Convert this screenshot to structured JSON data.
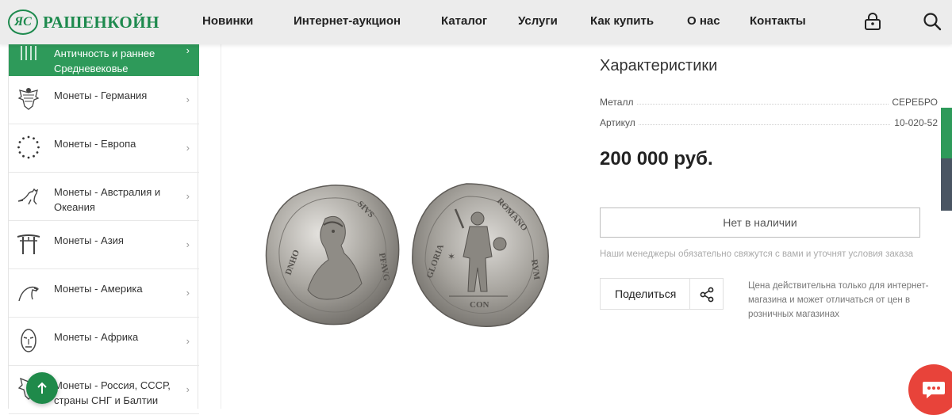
{
  "header": {
    "logo_mark": "ЯС",
    "logo_text": "РАШЕНКОЙН",
    "nav": [
      "Новинки",
      "Интернет-аукцион",
      "Каталог",
      "Услуги",
      "Как купить",
      "О нас",
      "Контакты"
    ],
    "icons": [
      "cart-lock-icon",
      "search-icon"
    ]
  },
  "sidebar": {
    "items": [
      {
        "label": "Античность и раннее Средневековье",
        "icon": "columns-icon",
        "active": true
      },
      {
        "label": "Монеты - Германия",
        "icon": "eagle-icon"
      },
      {
        "label": "Монеты - Европа",
        "icon": "eu-stars-icon"
      },
      {
        "label": "Монеты - Австралия и Океания",
        "icon": "kangaroo-icon"
      },
      {
        "label": "Монеты - Азия",
        "icon": "torii-icon"
      },
      {
        "label": "Монеты - Америка",
        "icon": "bald-eagle-icon"
      },
      {
        "label": "Монеты - Африка",
        "icon": "mask-icon"
      },
      {
        "label": "Монеты - Россия, СССР, страны СНГ и Балтии",
        "icon": "double-eagle-icon"
      }
    ],
    "chevron": "›"
  },
  "product": {
    "characteristics_title": "Характеристики",
    "properties": [
      {
        "name": "Металл",
        "value": "СЕРЕБРО"
      },
      {
        "name": "Артикул",
        "value": "10-020-52"
      }
    ],
    "price": "200 000 руб.",
    "stock_button": "Нет в наличии",
    "manager_note": "Наши менеджеры обязательно свяжутся с вами и уточнят условия заказа",
    "share_label": "Поделиться",
    "price_note": "Цена действительна только для интернет-магазина и может отличаться от цен в розничных магазинах"
  },
  "colors": {
    "brand_green": "#2e9a5a",
    "chat_red": "#e8433a",
    "edge_dark": "#4a5563"
  }
}
